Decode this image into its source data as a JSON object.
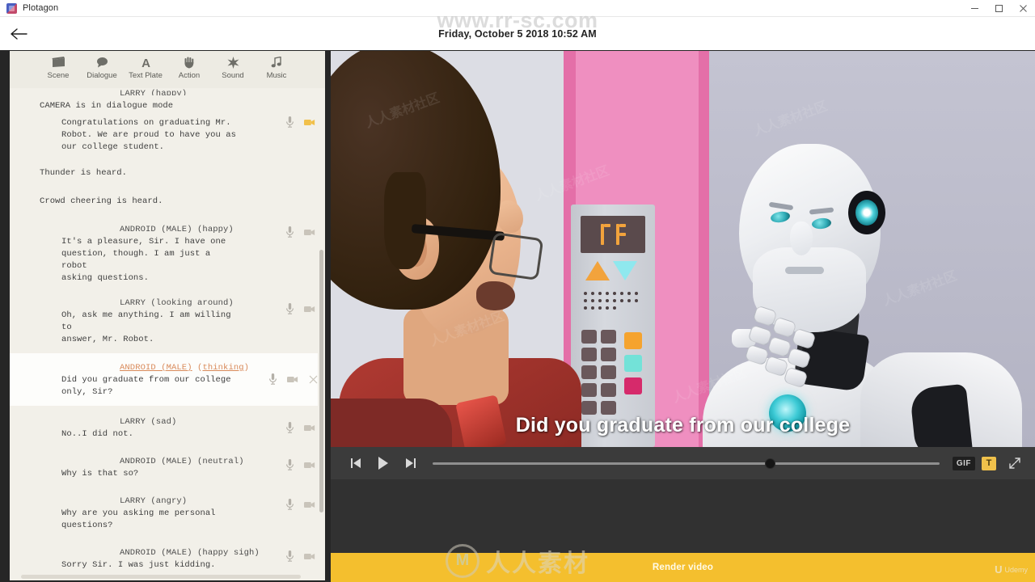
{
  "window": {
    "app_name": "Plotagon",
    "minimize_label": "Minimize",
    "maximize_label": "Maximize",
    "close_label": "Close"
  },
  "header": {
    "back_label": "Back",
    "date": "Friday, October 5 2018 10:52 AM"
  },
  "toolbar": {
    "items": [
      {
        "label": "Scene",
        "icon": "clapperboard-icon"
      },
      {
        "label": "Dialogue",
        "icon": "speech-bubble-icon"
      },
      {
        "label": "Text Plate",
        "icon": "letter-a-icon"
      },
      {
        "label": "Action",
        "icon": "hand-icon"
      },
      {
        "label": "Sound",
        "icon": "sparkle-icon"
      },
      {
        "label": "Music",
        "icon": "music-note-icon"
      }
    ]
  },
  "script": {
    "partial_top_cue": "LARRY (happy)",
    "blocks": [
      {
        "type": "direction",
        "text": "CAMERA is in dialogue mode",
        "has_mic": false,
        "has_camera": false
      },
      {
        "type": "dialogue",
        "text": "Congratulations on graduating Mr.\nRobot. We are proud to have you as\nour college student.",
        "has_mic": true,
        "has_camera": true,
        "camera_active": true
      },
      {
        "type": "direction",
        "text": "Thunder is heard.",
        "has_mic": false,
        "has_camera": false
      },
      {
        "type": "direction",
        "text": "Crowd cheering is heard.",
        "has_mic": false,
        "has_camera": false
      },
      {
        "type": "dialogue",
        "cue": "ANDROID (MALE) (happy)",
        "text": "It's a pleasure, Sir. I have one\nquestion, though. I am just a robot\nasking questions.",
        "has_mic": true,
        "has_camera": true,
        "camera_active": false
      },
      {
        "type": "dialogue",
        "cue": "LARRY (looking around)",
        "text": "Oh, ask me anything. I am willing to\nanswer, Mr. Robot.",
        "has_mic": true,
        "has_camera": true,
        "camera_active": false
      },
      {
        "type": "dialogue",
        "selected": true,
        "cue_character": "ANDROID (MALE)",
        "cue_emotion": "thinking",
        "cue": "ANDROID (MALE) (thinking)",
        "text": "Did you graduate from our college\nonly, Sir?",
        "has_mic": true,
        "has_camera": true,
        "has_delete": true,
        "camera_active": false
      },
      {
        "type": "dialogue",
        "cue": "LARRY (sad)",
        "text": "No..I did not.",
        "has_mic": true,
        "has_camera": true,
        "camera_active": false
      },
      {
        "type": "dialogue",
        "cue": "ANDROID (MALE) (neutral)",
        "text": "Why is that so?",
        "has_mic": true,
        "has_camera": true,
        "camera_active": false
      },
      {
        "type": "dialogue",
        "cue": "LARRY (angry)",
        "text": "Why are you asking me personal\nquestions?",
        "has_mic": true,
        "has_camera": true,
        "camera_active": false
      },
      {
        "type": "dialogue",
        "cue": "ANDROID (MALE) (happy sigh)",
        "text": "Sorry Sir. I was just kidding.",
        "has_mic": true,
        "has_camera": true,
        "camera_active": false
      }
    ]
  },
  "preview": {
    "subtitle": "Did you graduate from our college",
    "scene_description": "Man with glasses facing an android in an elevator lobby"
  },
  "player": {
    "prev_label": "Previous scene",
    "play_label": "Play",
    "next_label": "Next scene",
    "progress_percent": 66,
    "gif_label": "GIF",
    "text_label": "T",
    "fullscreen_label": "Fullscreen"
  },
  "render": {
    "button_label": "Render video",
    "brand": "Udemy",
    "brand_mark": "U"
  },
  "watermarks": {
    "top": "www.rr-sc.com",
    "center": "人人素材",
    "tile": "人人素材社区"
  },
  "colors": {
    "accent_yellow": "#f4bf2e",
    "script_bg": "#f2f0e9",
    "panel_dark": "#2d2d2d",
    "selected_cue": "#d98a5a"
  }
}
